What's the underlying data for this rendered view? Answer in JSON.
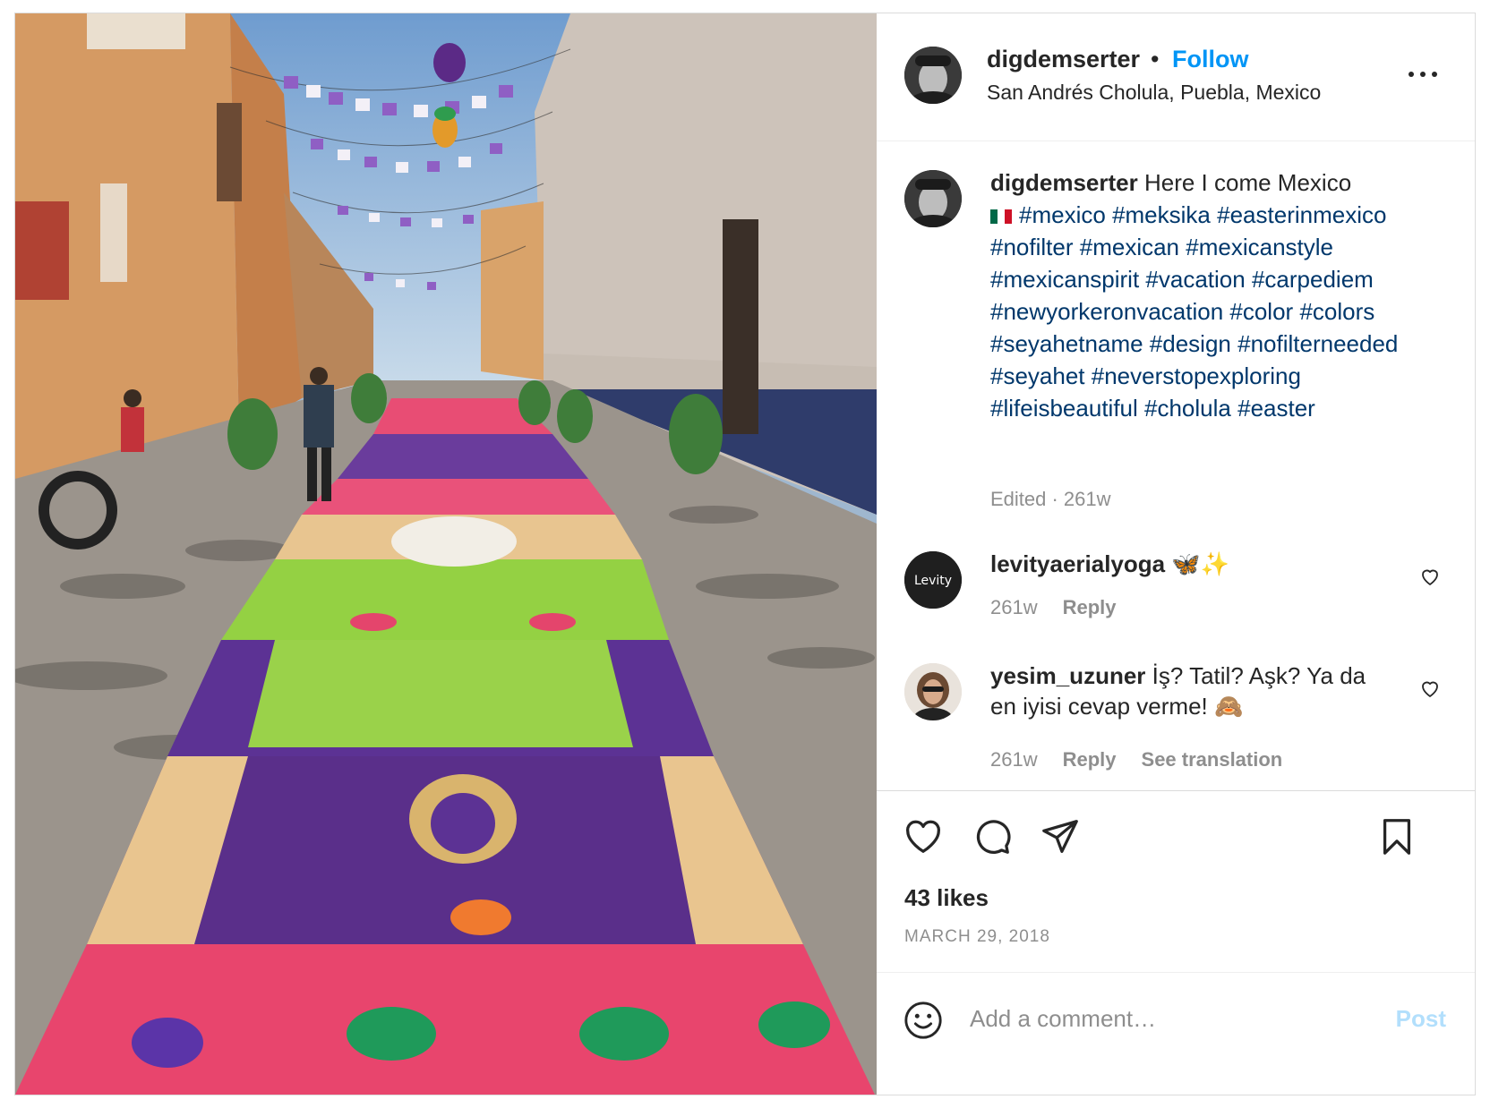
{
  "post": {
    "username": "digdemserter",
    "separator": "•",
    "follow_label": "Follow",
    "location": "San Andrés Cholula, Puebla, Mexico",
    "media_alt": "Street carpet of colored sawdust in Cholula with papel picado overhead"
  },
  "caption": {
    "username": "digdemserter",
    "text": "Here I come Mexico",
    "flag_emoji": "🇲🇽",
    "hashtags": [
      "#mexico",
      "#meksika",
      "#easterinmexico",
      "#nofilter",
      "#mexican",
      "#mexicanstyle",
      "#mexicanspirit",
      "#vacation",
      "#carpediem",
      "#newyorkeronvacation",
      "#color",
      "#colors",
      "#seyahetname",
      "#design",
      "#nofilterneeded",
      "#seyahet",
      "#neverstopexploring",
      "#lifeisbeautiful",
      "#cholula",
      "#easter"
    ],
    "meta": "Edited · 261w"
  },
  "comments": [
    {
      "username": "levityaerialyoga",
      "text": "🦋✨",
      "avatar_text": "Levity",
      "age": "261w",
      "reply_label": "Reply"
    },
    {
      "username": "yesim_uzuner",
      "text": "İş? Tatil? Aşk? Ya da en iyisi cevap verme! 🙈",
      "age": "261w",
      "reply_label": "Reply",
      "translation_label": "See translation"
    }
  ],
  "actions": {
    "icons": [
      "heart-icon",
      "comment-icon",
      "share-icon",
      "bookmark-icon"
    ]
  },
  "likes": "43 likes",
  "date": "MARCH 29, 2018",
  "add_comment": {
    "placeholder": "Add a comment…",
    "post_label": "Post"
  },
  "colors": {
    "accent": "#0095f6",
    "hashtag": "#00376b",
    "muted": "#8e8e8e",
    "post_disabled": "#b2dffc"
  }
}
